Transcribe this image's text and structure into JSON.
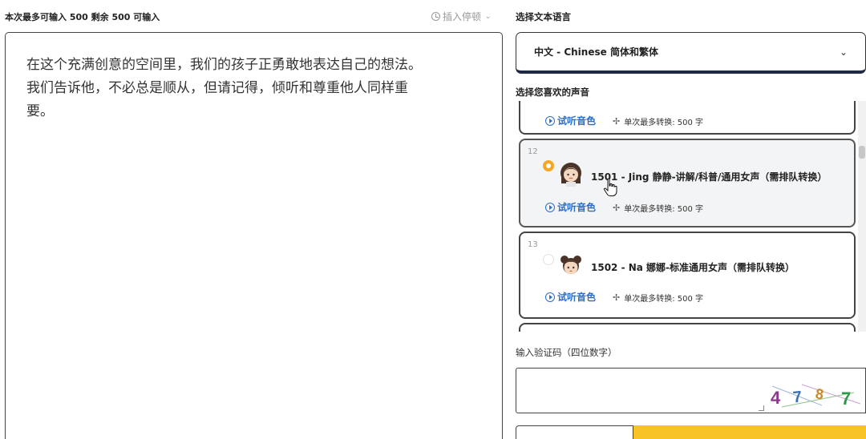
{
  "editor": {
    "top_info": "本次最多可输入 500 剩余 500 可输入",
    "insert_pause": "插入停顿",
    "text": "在这个充满创意的空间里，我们的孩子正勇敢地表达自己的想法。\n我们告诉他，不必总是顺从，但请记得，倾听和尊重他人同样重\n要。"
  },
  "language": {
    "label": "选择文本语言",
    "selected": "中文 - Chinese 简体和繁体"
  },
  "voices": {
    "label": "选择您喜欢的声音",
    "listen_label": "试听音色",
    "limit_label": "单次最多转换: 500 字",
    "items": [
      {
        "index": "12",
        "name": "1501 - Jing 静静-讲解/科普/通用女声（需排队转换）",
        "selected": true,
        "avatar": "girl-avatar-icon"
      },
      {
        "index": "13",
        "name": "1502 - Na 娜娜-标准通用女声（需排队转换）",
        "selected": false,
        "avatar": "girl-buns-avatar-icon"
      }
    ]
  },
  "captcha": {
    "label": "输入验证码（四位数字）",
    "input_value": "",
    "image_text": "4787"
  },
  "colors": {
    "accent": "#f5a623",
    "link": "#2a6fc9",
    "button_yellow": "#f7c325",
    "select_border": "#1e2a44"
  }
}
